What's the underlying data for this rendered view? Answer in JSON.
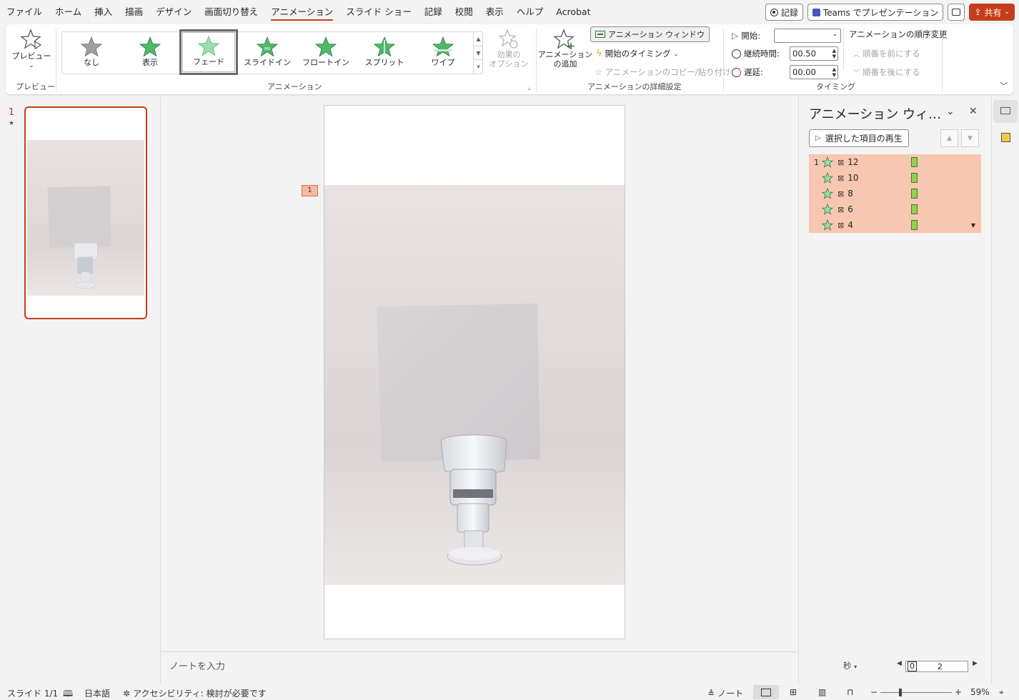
{
  "menu": {
    "tabs": [
      "ファイル",
      "ホーム",
      "挿入",
      "描画",
      "デザイン",
      "画面切り替え",
      "アニメーション",
      "スライド ショー",
      "記録",
      "校閲",
      "表示",
      "ヘルプ",
      "Acrobat"
    ],
    "active_tab": "アニメーション",
    "record_label": "記録",
    "teams_label": "Teams でプレゼンテーション",
    "share_label": "共有"
  },
  "ribbon": {
    "preview_label": "プレビュー",
    "preview_group": "プレビュー",
    "animation_group": "アニメーション",
    "gallery": [
      "なし",
      "表示",
      "フェード",
      "スライドイン",
      "フロートイン",
      "スプリット",
      "ワイプ"
    ],
    "gallery_selected": "フェード",
    "effect_options": [
      "効果の",
      "オプション"
    ],
    "add_animation": [
      "アニメーション",
      "の追加"
    ],
    "anim_pane_btn": "アニメーション ウィンドウ",
    "trigger": "開始のタイミング",
    "painter": "アニメーションのコピー/貼り付け",
    "advanced_group": "アニメーションの詳細設定",
    "start_label": "開始:",
    "start_value": "",
    "duration_label": "継続時間:",
    "duration_value": "00.50",
    "delay_label": "遅延:",
    "delay_value": "00.00",
    "reorder_title": "アニメーションの順序変更",
    "move_earlier": "順番を前にする",
    "move_later": "順番を後にする",
    "timing_group": "タイミング"
  },
  "thumbnails": {
    "slide_number": "1",
    "star": "★"
  },
  "slide": {
    "anim_tag": "1"
  },
  "notes_placeholder": "ノートを入力",
  "pane": {
    "title": "アニメーション ウィ…",
    "play_label": "選択した項目の再生",
    "items": [
      {
        "index": "1",
        "name": "12"
      },
      {
        "index": "",
        "name": "10"
      },
      {
        "index": "",
        "name": "8"
      },
      {
        "index": "",
        "name": "6"
      },
      {
        "index": "",
        "name": "4"
      }
    ],
    "seconds_label": "秒",
    "timeline_start": "0",
    "timeline_mid": "2"
  },
  "status": {
    "slide": "スライド 1/1",
    "language": "日本語",
    "accessibility": "アクセシビリティ: 検討が必要です",
    "notes": "ノート",
    "zoom": "59%"
  },
  "colors": {
    "accent": "#c43e1c",
    "anim_list_bg": "#f8c7b1",
    "anim_bar": "#92d050",
    "star_green": "#4fb868"
  }
}
